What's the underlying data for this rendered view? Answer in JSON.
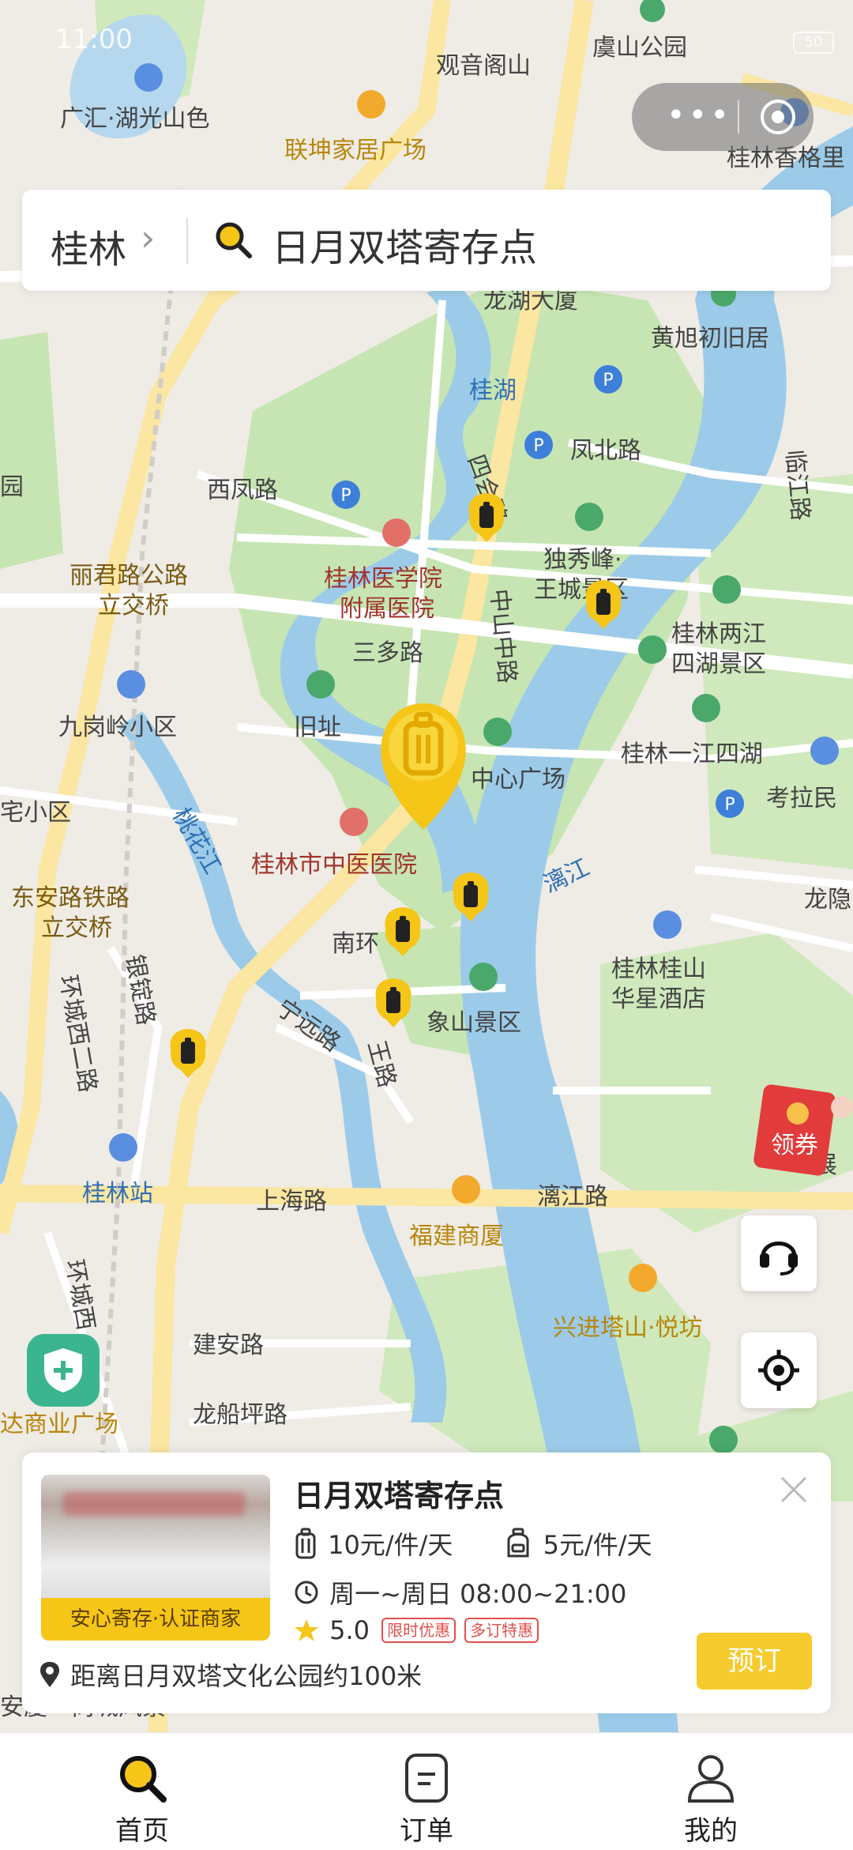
{
  "status_bar": {
    "time": "11:00",
    "battery": "50"
  },
  "search": {
    "city": "桂林",
    "query": "日月双塔寄存点"
  },
  "map": {
    "labels": {
      "l01": "观音阁山",
      "l02": "虞山公园",
      "l03": "广汇·湖光山色",
      "l04": "联坤家居广场",
      "l05": "桂林香格里",
      "l06": "龙湖大厦",
      "l07": "黄旭初旧居",
      "l08": "桂湖",
      "l09": "凤北路",
      "l10": "西凤路",
      "l11": "四会路",
      "l12": "独秀峰·",
      "l13": "王城景区",
      "l14": "桂林医学院",
      "l15": "附属医院",
      "l16": "丽君路公路",
      "l17": "立交桥",
      "l18": "中山中路",
      "l19": "三多路",
      "l20": "桂林两江",
      "l21": "四湖景区",
      "l22": "九岗岭小区",
      "l23": "旧址",
      "l24": "中心广场",
      "l25": "桂林一江四湖",
      "l26": "宅小区",
      "l27": "考拉民",
      "l28": "桃花江",
      "l29": "桂林市中医医院",
      "l30": "漓江",
      "l31": "龙隐",
      "l32": "东安路铁路",
      "l33": "立交桥",
      "l34": "南环",
      "l35": "桂林桂山",
      "l36": "华星酒店",
      "l37": "环城西二路",
      "l38": "银锭路",
      "l39": "象山景区",
      "l40": "宁远路",
      "l41": "王路",
      "l42": "桂林站",
      "l43": "上海路",
      "l44": "漓江路",
      "l45": "福建商厦",
      "l46": "环城西",
      "l47": "兴进塔山·悦坊",
      "l48": "建安路",
      "l49": "龙船坪路",
      "l50": "达商业广场",
      "l51": "安厦",
      "l52": "尚城风景",
      "l53": "临江路",
      "l54": "园",
      "l55": "展"
    },
    "markers": {
      "selected": "日月双塔寄存点"
    }
  },
  "floating": {
    "coupon_label": "领券"
  },
  "card": {
    "title": "日月双塔寄存点",
    "badge": "安心寄存·认证商家",
    "price_suitcase": "10元/件/天",
    "price_backpack": "5元/件/天",
    "hours": "周一~周日 08:00~21:00",
    "rating": "5.0",
    "tags": [
      "限时优惠",
      "多订特惠"
    ],
    "distance": "距离日月双塔文化公园约100米",
    "book_label": "预订"
  },
  "tabs": [
    {
      "label": "首页",
      "active": true
    },
    {
      "label": "订单",
      "active": false
    },
    {
      "label": "我的",
      "active": false
    }
  ],
  "colors": {
    "accent": "#f6cb2d",
    "water": "#9ccbe9",
    "park": "#bfe2a8",
    "road_major": "#fbe6a2"
  }
}
